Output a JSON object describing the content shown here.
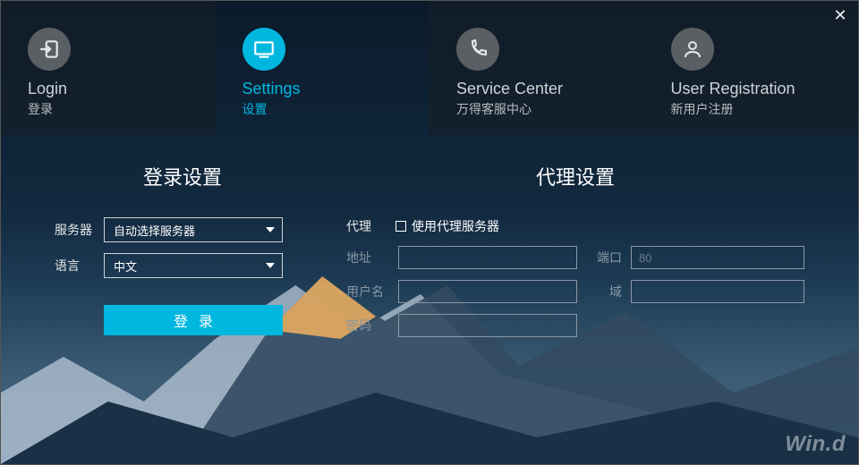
{
  "tabs": {
    "login": {
      "title_en": "Login",
      "title_cn": "登录"
    },
    "settings": {
      "title_en": "Settings",
      "title_cn": "设置"
    },
    "service": {
      "title_en": "Service Center",
      "title_cn": "万得客服中心"
    },
    "register": {
      "title_en": "User Registration",
      "title_cn": "新用户注册"
    }
  },
  "sections": {
    "login_settings": "登录设置",
    "proxy_settings": "代理设置"
  },
  "login": {
    "server_label": "服务器",
    "server_value": "自动选择服务器",
    "language_label": "语言",
    "language_value": "中文",
    "button": "登录"
  },
  "proxy": {
    "label": "代理",
    "use_proxy_label": "使用代理服务器",
    "address_label": "地址",
    "port_label": "端口",
    "port_placeholder": "80",
    "user_label": "用户名",
    "domain_label": "域",
    "password_label": "密码"
  },
  "brand": "Win.d",
  "colors": {
    "accent": "#00b7e0"
  }
}
